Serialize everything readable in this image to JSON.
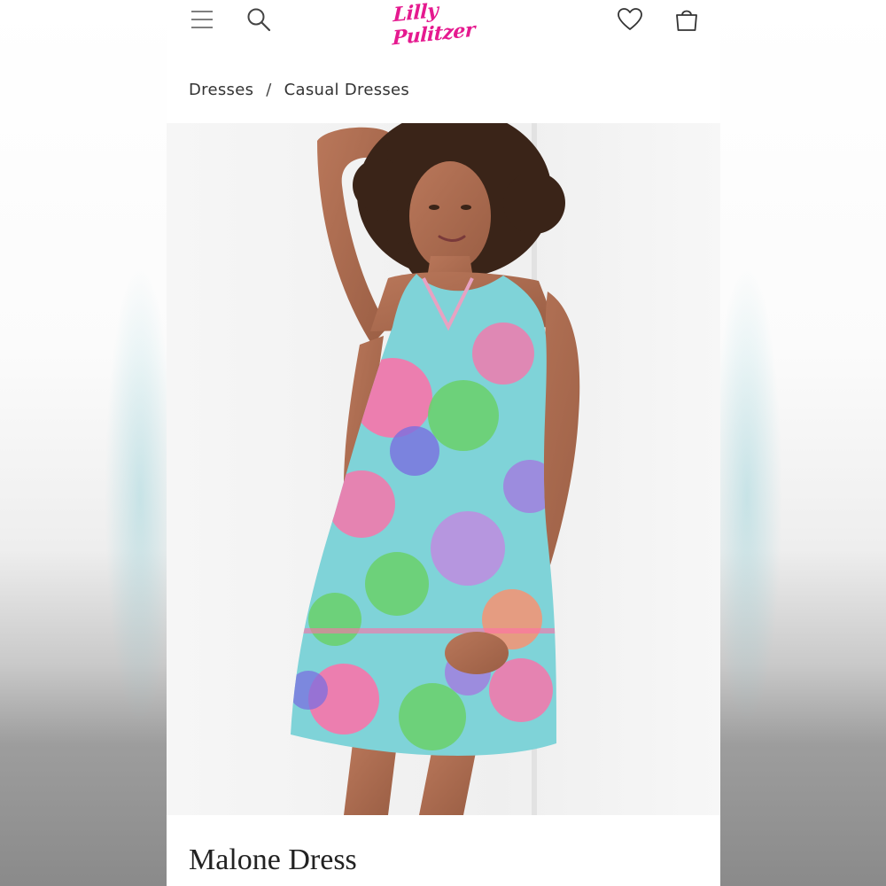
{
  "brand": {
    "logo_text": "Lilly Pulitzer",
    "color": "#e5198f"
  },
  "header": {
    "menu_icon": "hamburger-menu-icon",
    "search_icon": "search-icon",
    "wishlist_icon": "heart-icon",
    "bag_icon": "shopping-bag-icon"
  },
  "breadcrumb": {
    "items": [
      "Dresses",
      "Casual Dresses"
    ],
    "separator": "/"
  },
  "product": {
    "title": "Malone Dress",
    "print_colors": [
      "#7fd3d8",
      "#ff6fa8",
      "#6ad06a",
      "#a47be0",
      "#ff8f6b"
    ]
  }
}
